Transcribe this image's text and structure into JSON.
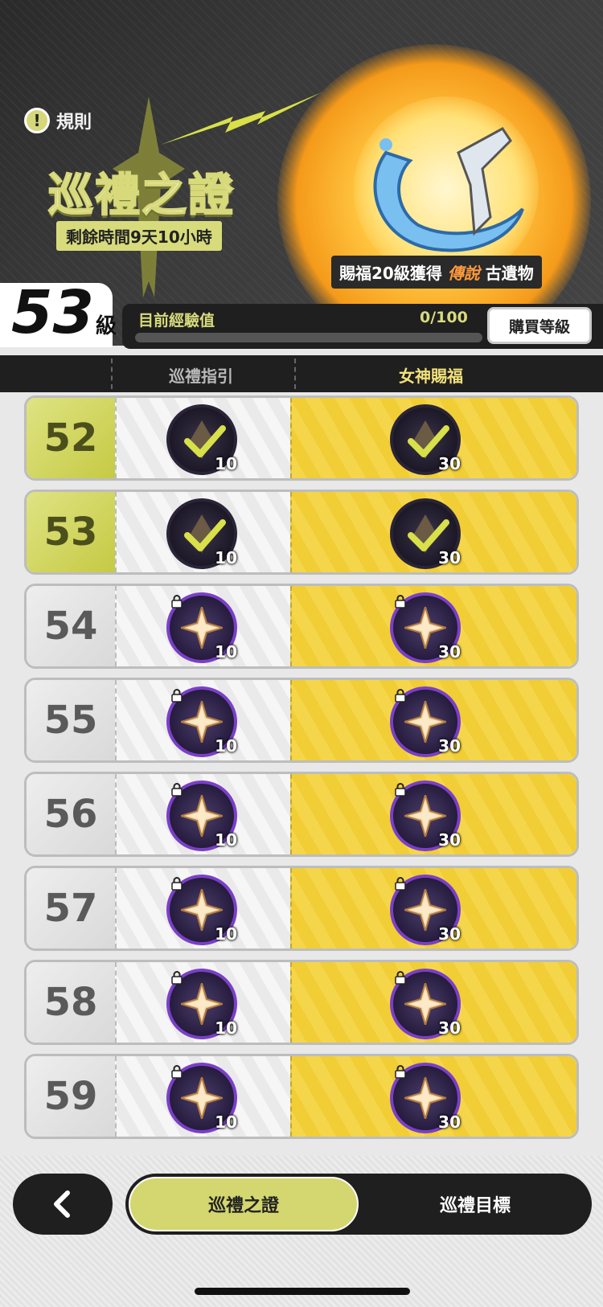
{
  "header": {
    "rules_label": "規則",
    "rules_icon": "!",
    "title": "巡禮之證",
    "time_remaining": "剩餘時間9天10小時",
    "reward_prefix": "賜福20級獲得",
    "reward_rarity": "傳說",
    "reward_suffix": "古遺物"
  },
  "level": {
    "current": "53",
    "unit": "級",
    "exp_label": "目前經驗值",
    "exp_value": "0/100",
    "exp_fraction": 0.0,
    "buy_label": "購買等級"
  },
  "columns": {
    "free": "巡禮指引",
    "paid": "女神賜福"
  },
  "rows": [
    {
      "level": "52",
      "free_qty": "10",
      "paid_qty": "30",
      "claimed": true
    },
    {
      "level": "53",
      "free_qty": "10",
      "paid_qty": "30",
      "claimed": true
    },
    {
      "level": "54",
      "free_qty": "10",
      "paid_qty": "30",
      "claimed": false
    },
    {
      "level": "55",
      "free_qty": "10",
      "paid_qty": "30",
      "claimed": false
    },
    {
      "level": "56",
      "free_qty": "10",
      "paid_qty": "30",
      "claimed": false
    },
    {
      "level": "57",
      "free_qty": "10",
      "paid_qty": "30",
      "claimed": false
    },
    {
      "level": "58",
      "free_qty": "10",
      "paid_qty": "30",
      "claimed": false
    },
    {
      "level": "59",
      "free_qty": "10",
      "paid_qty": "30",
      "claimed": false
    }
  ],
  "bottom_nav": {
    "back_icon": "chevron-left-icon",
    "tab_active": "巡禮之證",
    "tab_inactive": "巡禮目標"
  },
  "colors": {
    "accent": "#d4d66f",
    "paid_bg": "#f5d64a",
    "legend_orange": "#ff9a3c",
    "item_border": "#7a3fc8"
  }
}
